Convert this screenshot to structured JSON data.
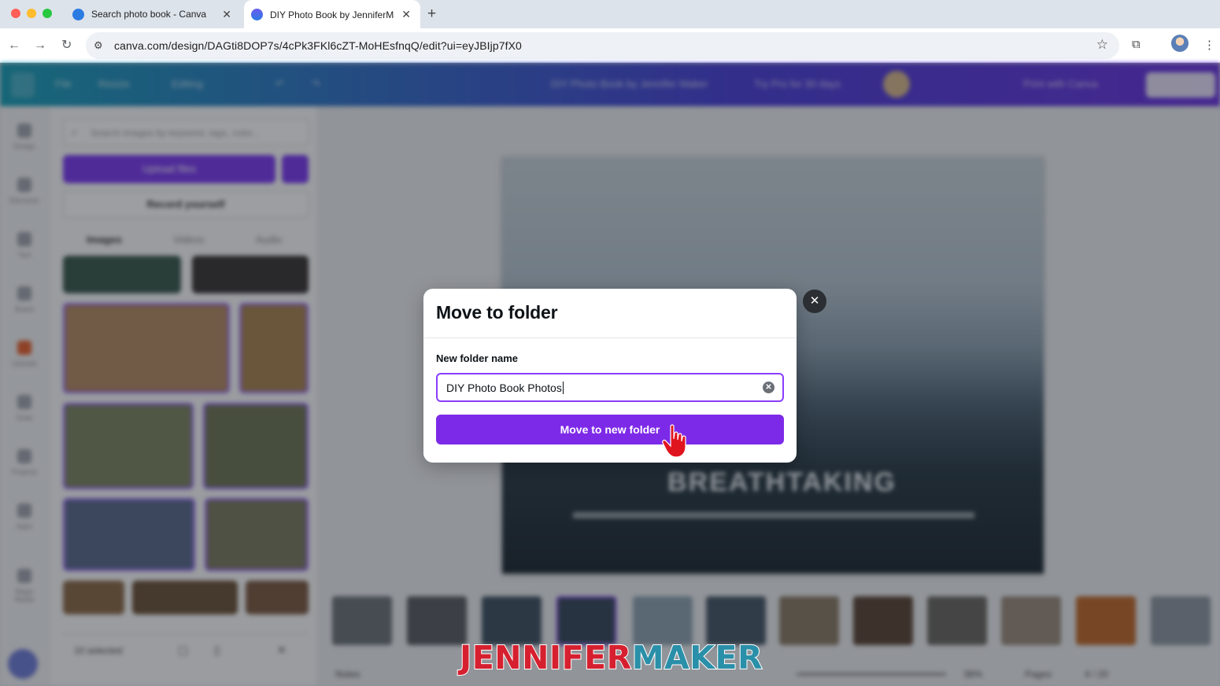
{
  "browser": {
    "tabs": [
      {
        "title": "Search photo book - Canva",
        "active": false,
        "favicon_color": "#2b7be3"
      },
      {
        "title": "DIY Photo Book by JenniferMaker",
        "active": true,
        "favicon_color": "#5a4fcf"
      }
    ],
    "new_tab_icon": "plus-icon",
    "url": "canva.com/design/DAGti8DOP7s/4cPk3FKl6cZT-MoHEsfnqQ/edit?ui=eyJBIjp7fX0",
    "traffic_lights": [
      "#ff5f57",
      "#febc2e",
      "#28c840"
    ]
  },
  "canva": {
    "header_items": [
      "File",
      "Resize",
      "Editing",
      "DIY Photo Book by Jennifer Maker",
      "Try Pro for 30 days",
      "Print with Canva",
      "Share"
    ],
    "rail_items": [
      "Design",
      "Elements",
      "Text",
      "Brand",
      "Uploads",
      "Draw",
      "Projects",
      "Apps",
      "Magic Media"
    ],
    "panel": {
      "search_placeholder": "Search images by keyword, tags, color...",
      "upload_label": "Upload files",
      "record_label": "Record yourself",
      "tabs": [
        "Images",
        "Videos",
        "Audio"
      ],
      "selected_label": "10 selected"
    },
    "photo_title": "BREATHTAKING",
    "footer": {
      "notes": "Notes",
      "zoom": "38%",
      "pages": "Pages",
      "page_count": "4 / 20"
    },
    "accent": "#7d2ae8"
  },
  "modal": {
    "title": "Move to folder",
    "field_label": "New folder name",
    "field_value": "DIY Photo Book Photos",
    "clear_icon": "clear-circle-icon",
    "submit_label": "Move to new folder",
    "close_icon": "close-icon"
  },
  "watermark": {
    "part1": "JENNIFER",
    "part2": "MAKER"
  }
}
